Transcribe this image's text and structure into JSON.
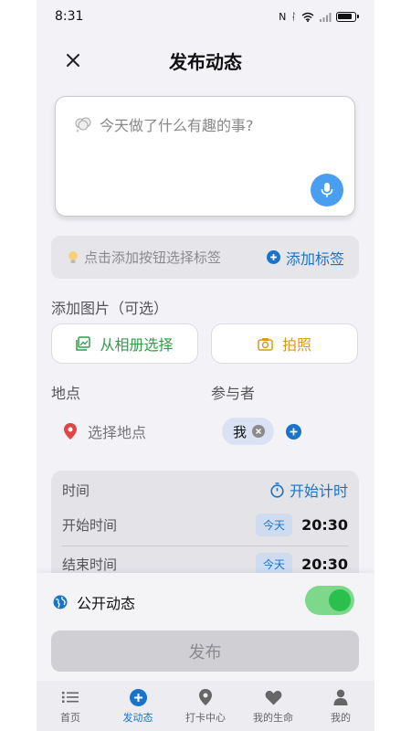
{
  "status_bar": {
    "time": "8:31"
  },
  "header": {
    "title": "发布动态"
  },
  "post": {
    "placeholder": "今天做了什么有趣的事?"
  },
  "tags": {
    "hint": "点击添加按钮选择标签",
    "add_label": "添加标签"
  },
  "photos": {
    "section_label": "添加图片（可选）",
    "album_label": "从相册选择",
    "camera_label": "拍照"
  },
  "location": {
    "section_label": "地点",
    "placeholder": "选择地点"
  },
  "participants": {
    "section_label": "参与者",
    "items": [
      "我"
    ]
  },
  "time": {
    "section_label": "时间",
    "timer_label": "开始计时",
    "start": {
      "label": "开始时间",
      "day": "今天",
      "time": "20:30"
    },
    "end": {
      "label": "结束时间",
      "day": "今天",
      "time": "20:30"
    }
  },
  "public": {
    "label": "公开动态",
    "enabled": true
  },
  "publish_label": "发布",
  "tabs": [
    {
      "label": "首页",
      "icon": "list-icon",
      "active": false
    },
    {
      "label": "发动态",
      "icon": "plus-circle-icon",
      "active": true
    },
    {
      "label": "打卡中心",
      "icon": "location-pin-icon",
      "active": false
    },
    {
      "label": "我的生命",
      "icon": "heart-icon",
      "active": false
    },
    {
      "label": "我的",
      "icon": "person-icon",
      "active": false
    }
  ],
  "colors": {
    "accent": "#1a73c8",
    "green": "#2bbf4c",
    "amber": "#d89a1a",
    "red": "#e04646",
    "mic": "#4a9ef0"
  }
}
